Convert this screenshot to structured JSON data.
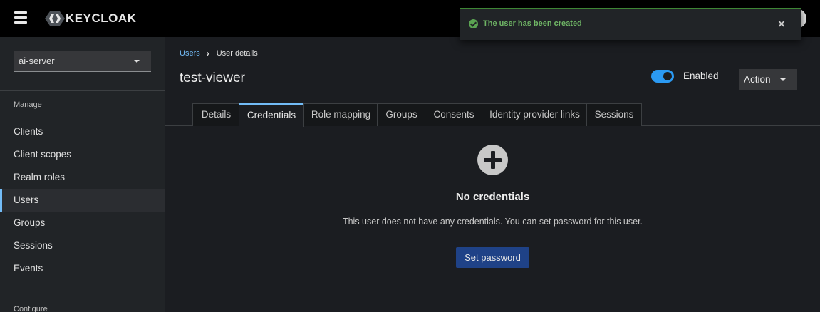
{
  "header": {
    "logo_text": "KEYCLOAK"
  },
  "toast": {
    "message": "The user has been created",
    "close_glyph": "×",
    "accent_color": "#3e8635"
  },
  "sidebar": {
    "realm": "ai-server",
    "sections": [
      {
        "heading": "Manage"
      },
      {
        "heading": "Configure"
      }
    ],
    "items": [
      {
        "label": "Clients"
      },
      {
        "label": "Client scopes"
      },
      {
        "label": "Realm roles"
      },
      {
        "label": "Users",
        "active": true
      },
      {
        "label": "Groups"
      },
      {
        "label": "Sessions"
      },
      {
        "label": "Events"
      }
    ]
  },
  "breadcrumb": {
    "parent": "Users",
    "current": "User details"
  },
  "page": {
    "title": "test-viewer",
    "enabled_label": "Enabled",
    "enabled": true,
    "action_label": "Action"
  },
  "tabs": [
    {
      "label": "Details"
    },
    {
      "label": "Credentials",
      "active": true
    },
    {
      "label": "Role mapping"
    },
    {
      "label": "Groups"
    },
    {
      "label": "Consents"
    },
    {
      "label": "Identity provider links"
    },
    {
      "label": "Sessions"
    }
  ],
  "empty_state": {
    "icon": "plus-circle-icon",
    "title": "No credentials",
    "body": "This user does not have any credentials. You can set password for this user.",
    "button": "Set password"
  }
}
